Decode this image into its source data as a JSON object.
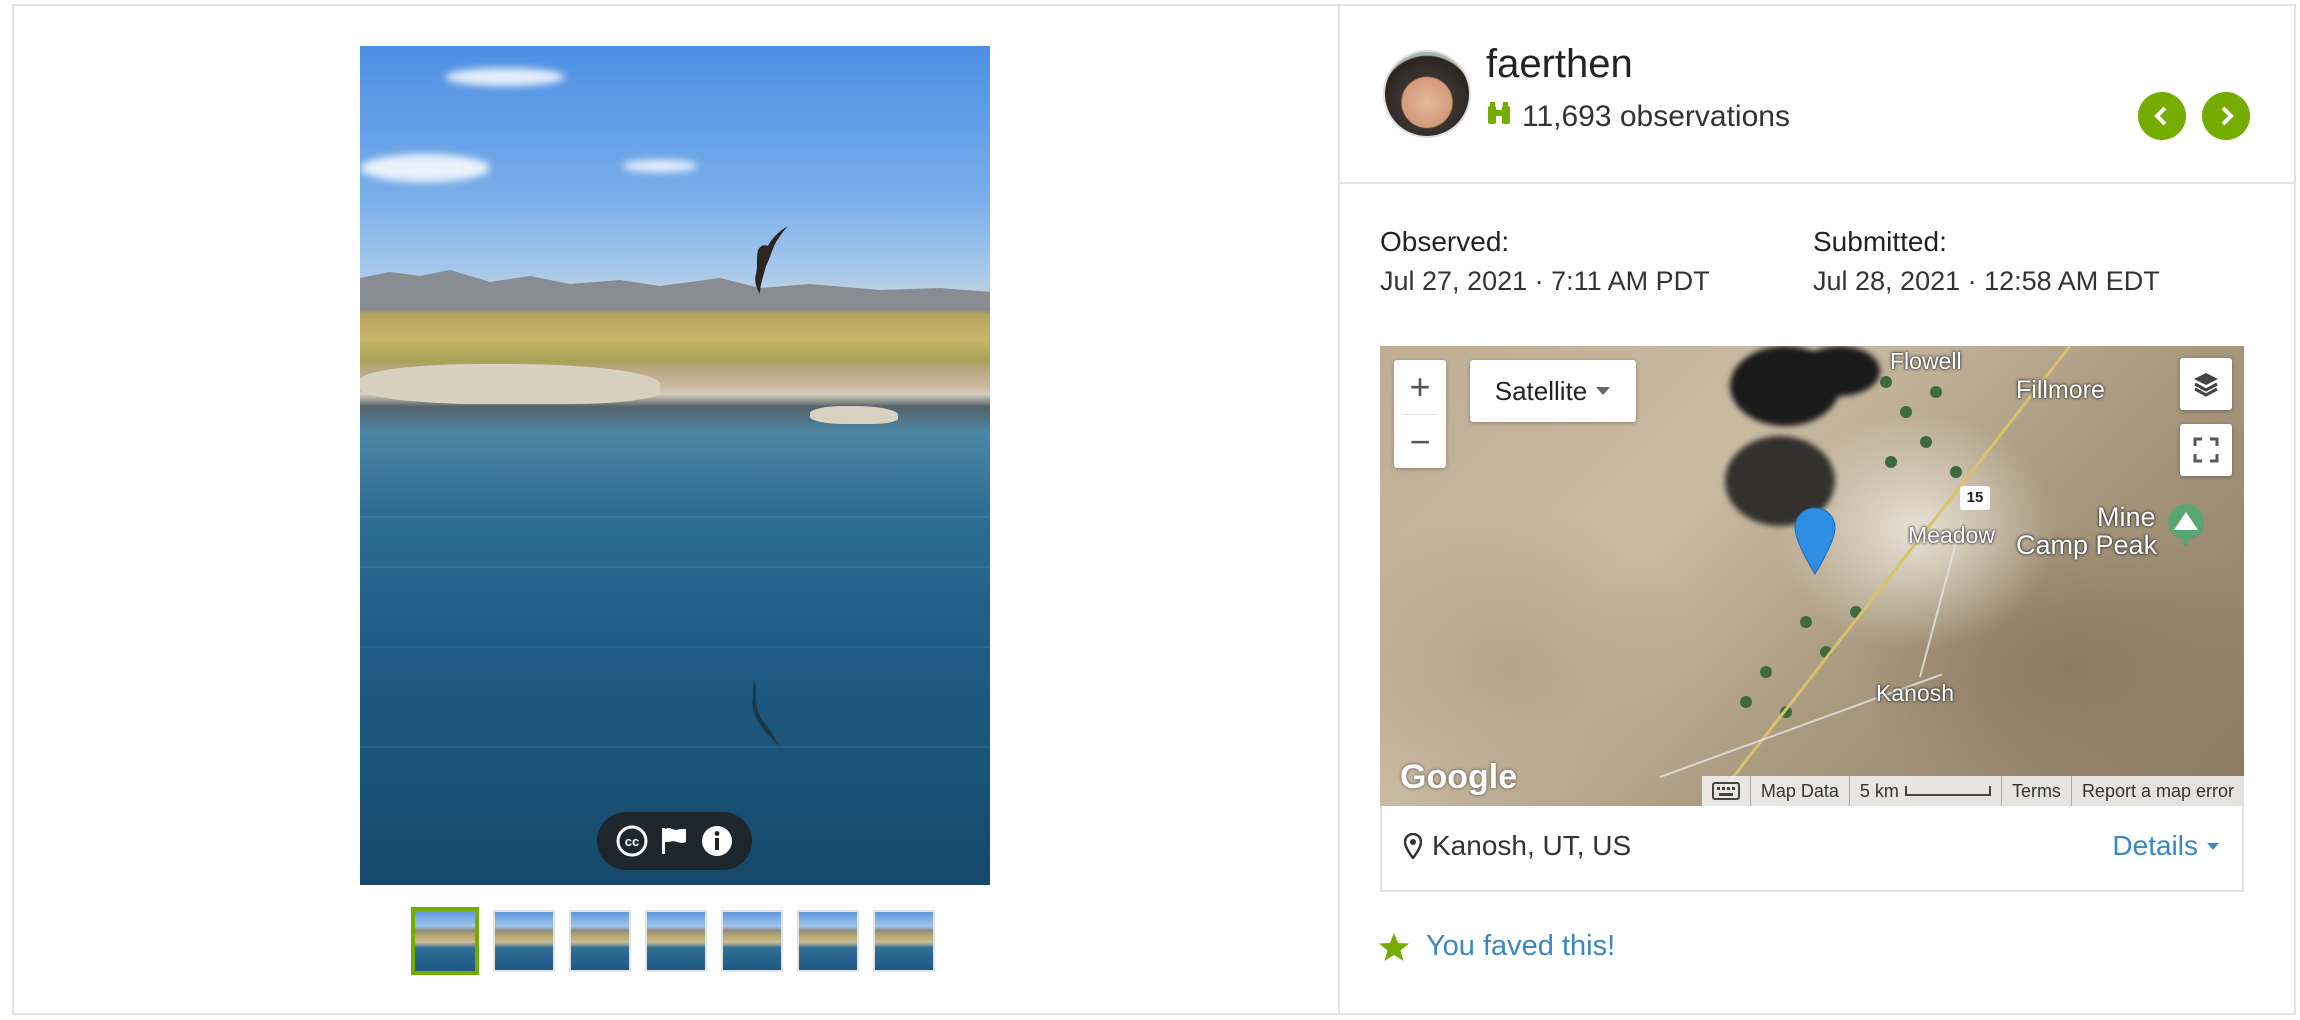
{
  "user": {
    "name": "faerthen",
    "observations": "11,693 observations"
  },
  "observed": {
    "label": "Observed:",
    "value": "Jul 27, 2021 · 7:11 AM PDT"
  },
  "submitted": {
    "label": "Submitted:",
    "value": "Jul 28, 2021 · 12:58 AM EDT"
  },
  "map": {
    "type_label": "Satellite",
    "zoom_in": "+",
    "zoom_out": "−",
    "google": "Google",
    "labels": {
      "flowell": "Flowell",
      "fillmore": "Fillmore",
      "meadow": "Meadow",
      "mine": "Mine",
      "camp_peak": "Camp Peak",
      "kanosh": "Kanosh",
      "highway": "15"
    },
    "footer": {
      "map_data": "Map Data",
      "scale": "5 km",
      "terms": "Terms",
      "report": "Report a map error"
    }
  },
  "location": {
    "text": "Kanosh, UT, US",
    "details": "Details"
  },
  "fave": {
    "text": "You faved this!"
  },
  "colors": {
    "accent_green": "#74ac00",
    "link_blue": "#3a87c4",
    "pin_blue": "#2f8de4"
  },
  "icons": [
    "binoculars-icon",
    "chevron-left-icon",
    "chevron-right-icon",
    "cc-license-icon",
    "flag-icon",
    "info-icon",
    "layers-icon",
    "fullscreen-icon",
    "keyboard-icon",
    "map-pin-icon",
    "caret-down-icon",
    "star-icon"
  ]
}
